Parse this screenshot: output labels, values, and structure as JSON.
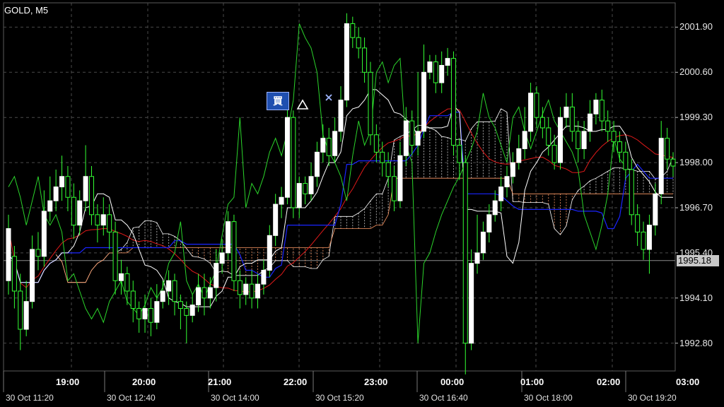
{
  "header": {
    "symbol": "GOLD, M5"
  },
  "colors": {
    "background": "#000000",
    "grid": "#4a4a4a",
    "candle_bull": "#ffffff",
    "candle_bear": "#33ff33",
    "chikou": "#2bd42b",
    "tenkan": "#ffffff",
    "kijun": "#1a24ff",
    "sma": "#e01a1a",
    "span_a": "#ffffff",
    "span_b": "#ff9a66",
    "marker_buy": "#2f4fd0",
    "current_price_bg": "#c8c8c8"
  },
  "markers": {
    "buy_label": "買",
    "buy_arrow": "△",
    "exit_mark": "×"
  },
  "current_price": "1995.18",
  "chart_data": {
    "type": "candlestick",
    "title": "GOLD, M5",
    "y_axis": {
      "range": [
        1992.0,
        2002.6
      ],
      "ticks": [
        "2001.90",
        "2000.60",
        "1999.30",
        "1998.00",
        "1996.70",
        "1995.40",
        "1994.10",
        "1992.80"
      ],
      "tick_values": [
        2001.9,
        2000.6,
        1999.3,
        1998.0,
        1996.7,
        1995.4,
        1994.1,
        1992.8
      ]
    },
    "session_times": [
      "19:00",
      "20:00",
      "21:00",
      "22:00",
      "23:00",
      "00:00",
      "01:00",
      "02:00",
      "03:00"
    ],
    "date_ticks": [
      "30 Oct 11:20",
      "30 Oct 12:40",
      "30 Oct 14:00",
      "30 Oct 15:20",
      "30 Oct 16:40",
      "30 Oct 18:00",
      "30 Oct 19:20"
    ],
    "grid": true,
    "current_price": 1995.18,
    "candles": [
      [
        1994.6,
        1996.1,
        1994.2,
        1996.5
      ],
      [
        1995.3,
        1994.3,
        1993.8,
        1995.6
      ],
      [
        1994.3,
        1993.2,
        1992.6,
        1994.8
      ],
      [
        1993.2,
        1994.0,
        1993.0,
        1994.6
      ],
      [
        1994.0,
        1995.5,
        1993.8,
        1995.9
      ],
      [
        1995.5,
        1995.3,
        1994.9,
        1996.0
      ],
      [
        1995.3,
        1996.6,
        1995.0,
        1997.2
      ],
      [
        1996.6,
        1996.9,
        1996.3,
        1997.6
      ],
      [
        1996.9,
        1997.3,
        1996.6,
        1997.8
      ],
      [
        1997.3,
        1997.6,
        1996.9,
        1998.2
      ],
      [
        1997.6,
        1997.0,
        1996.6,
        1997.9
      ],
      [
        1997.0,
        1996.2,
        1995.8,
        1997.4
      ],
      [
        1996.2,
        1996.9,
        1995.9,
        1997.2
      ],
      [
        1996.9,
        1997.6,
        1996.6,
        1998.5
      ],
      [
        1997.6,
        1996.5,
        1996.2,
        1997.9
      ],
      [
        1996.5,
        1996.2,
        1995.7,
        1996.8
      ],
      [
        1996.2,
        1996.5,
        1995.9,
        1997.0
      ],
      [
        1996.5,
        1996.0,
        1995.5,
        1996.8
      ],
      [
        1996.0,
        1994.6,
        1994.2,
        1996.3
      ],
      [
        1994.6,
        1994.8,
        1994.2,
        1995.2
      ],
      [
        1994.8,
        1994.3,
        1993.9,
        1995.0
      ],
      [
        1994.3,
        1993.8,
        1993.4,
        1994.6
      ],
      [
        1993.8,
        1993.5,
        1993.1,
        1994.0
      ],
      [
        1993.5,
        1993.8,
        1993.1,
        1994.2
      ],
      [
        1993.8,
        1993.4,
        1993.0,
        1994.1
      ],
      [
        1993.4,
        1994.0,
        1993.2,
        1994.5
      ],
      [
        1994.0,
        1994.3,
        1993.8,
        1994.6
      ],
      [
        1994.3,
        1994.6,
        1993.9,
        1994.9
      ],
      [
        1994.6,
        1994.0,
        1993.6,
        1994.8
      ],
      [
        1994.0,
        1993.8,
        1993.2,
        1994.2
      ],
      [
        1993.8,
        1993.6,
        1992.8,
        1994.0
      ],
      [
        1993.6,
        1993.9,
        1993.4,
        1994.2
      ],
      [
        1993.9,
        1994.4,
        1993.7,
        1994.8
      ],
      [
        1994.4,
        1994.1,
        1993.6,
        1994.8
      ],
      [
        1994.1,
        1994.4,
        1993.8,
        1994.7
      ],
      [
        1994.4,
        1995.1,
        1994.0,
        1995.5
      ],
      [
        1995.1,
        1995.4,
        1994.8,
        1995.8
      ],
      [
        1995.4,
        1996.3,
        1995.2,
        1996.6
      ],
      [
        1996.3,
        1994.6,
        1994.3,
        1996.5
      ],
      [
        1994.6,
        1994.2,
        1993.8,
        1994.9
      ],
      [
        1994.2,
        1994.5,
        1993.9,
        1994.7
      ],
      [
        1994.5,
        1994.1,
        1993.8,
        1994.9
      ],
      [
        1994.1,
        1994.5,
        1993.8,
        1994.8
      ],
      [
        1994.5,
        1994.9,
        1994.2,
        1995.2
      ],
      [
        1994.9,
        1995.9,
        1994.7,
        1996.2
      ],
      [
        1995.9,
        1996.8,
        1995.6,
        1997.1
      ],
      [
        1996.8,
        1997.0,
        1996.4,
        1997.3
      ],
      [
        1997.0,
        1999.3,
        1996.8,
        1999.6
      ],
      [
        1999.3,
        1996.7,
        1996.4,
        1999.5
      ],
      [
        1996.7,
        1997.4,
        1996.4,
        1997.6
      ],
      [
        1997.4,
        1997.1,
        1996.8,
        1997.6
      ],
      [
        1997.1,
        1997.6,
        1996.9,
        1998.0
      ],
      [
        1997.6,
        1998.3,
        1997.3,
        1998.6
      ],
      [
        1998.3,
        1998.7,
        1998.0,
        1999.1
      ],
      [
        1998.7,
        1998.2,
        1997.9,
        1999.0
      ],
      [
        1998.2,
        1998.9,
        1998.0,
        1999.3
      ],
      [
        1998.9,
        1999.8,
        1998.6,
        2000.2
      ],
      [
        1999.8,
        2002.0,
        1999.6,
        2002.3
      ],
      [
        2002.0,
        2001.6,
        2001.3,
        2002.2
      ],
      [
        2001.6,
        2001.3,
        2001.0,
        2001.9
      ],
      [
        2001.3,
        2000.6,
        2000.3,
        2001.6
      ],
      [
        2000.6,
        1998.8,
        1998.5,
        2000.9
      ],
      [
        1998.8,
        1998.3,
        1998.0,
        1999.1
      ],
      [
        1998.3,
        1998.0,
        1997.6,
        1998.6
      ],
      [
        1998.0,
        1997.6,
        1997.3,
        1998.3
      ],
      [
        1997.6,
        1996.9,
        1996.6,
        1997.9
      ],
      [
        1996.9,
        1998.2,
        1996.7,
        1998.6
      ],
      [
        1998.2,
        1999.2,
        1997.9,
        1999.6
      ],
      [
        1999.2,
        1998.5,
        1998.2,
        1999.5
      ],
      [
        1998.5,
        1998.9,
        1998.2,
        2000.6
      ],
      [
        1998.9,
        2000.6,
        1998.7,
        2001.4
      ],
      [
        2000.6,
        2000.9,
        2000.4,
        2001.1
      ],
      [
        2000.9,
        2000.3,
        2000.0,
        2001.1
      ],
      [
        2000.3,
        2000.8,
        2000.0,
        2001.2
      ],
      [
        2000.8,
        2001.0,
        2000.5,
        2001.3
      ],
      [
        2001.0,
        1998.5,
        1998.2,
        2001.2
      ],
      [
        1998.5,
        1998.0,
        1997.5,
        1998.7
      ],
      [
        1998.0,
        1992.8,
        1991.9,
        1998.2
      ],
      [
        1992.8,
        1995.1,
        1992.6,
        1995.5
      ],
      [
        1995.1,
        1995.4,
        1994.8,
        1996.5
      ],
      [
        1995.4,
        1996.0,
        1995.2,
        1996.3
      ],
      [
        1996.0,
        1996.5,
        1995.7,
        1996.8
      ],
      [
        1996.5,
        1996.9,
        1996.3,
        1997.2
      ],
      [
        1996.9,
        1997.3,
        1996.6,
        1997.6
      ],
      [
        1997.3,
        1997.6,
        1997.0,
        1997.9
      ],
      [
        1997.6,
        1998.0,
        1997.4,
        1998.3
      ],
      [
        1998.0,
        1998.4,
        1997.8,
        1998.8
      ],
      [
        1998.4,
        1998.9,
        1998.1,
        1999.6
      ],
      [
        1998.9,
        2000.0,
        1998.6,
        2000.3
      ],
      [
        2000.0,
        1999.3,
        1999.0,
        2000.2
      ],
      [
        1999.3,
        1999.0,
        1998.7,
        1999.6
      ],
      [
        1999.0,
        1998.5,
        1998.2,
        1999.3
      ],
      [
        1998.5,
        1998.0,
        1997.8,
        1998.8
      ],
      [
        1998.0,
        1999.3,
        1997.8,
        1999.6
      ],
      [
        1999.3,
        1999.6,
        1999.0,
        2000.0
      ],
      [
        1999.6,
        1998.9,
        1998.6,
        2000.0
      ],
      [
        1998.9,
        1998.4,
        1998.0,
        1999.2
      ],
      [
        1998.4,
        1998.9,
        1998.1,
        1999.2
      ],
      [
        1998.9,
        1999.4,
        1998.6,
        1999.8
      ],
      [
        1999.4,
        1999.8,
        1999.1,
        2000.0
      ],
      [
        1999.8,
        1999.2,
        1998.9,
        2000.1
      ],
      [
        1999.2,
        1998.9,
        1998.6,
        1999.5
      ],
      [
        1998.9,
        1998.6,
        1998.3,
        1999.2
      ],
      [
        1998.6,
        1998.3,
        1998.0,
        1998.9
      ],
      [
        1998.3,
        1997.8,
        1997.5,
        1998.6
      ],
      [
        1997.8,
        1996.5,
        1996.2,
        1998.1
      ],
      [
        1996.5,
        1996.0,
        1995.6,
        1996.8
      ],
      [
        1996.0,
        1995.5,
        1995.2,
        1996.3
      ],
      [
        1995.5,
        1996.2,
        1994.8,
        1996.5
      ],
      [
        1996.2,
        1997.1,
        1995.9,
        1997.4
      ],
      [
        1997.1,
        1998.7,
        1996.8,
        1999.2
      ],
      [
        1998.7,
        1998.1,
        1997.8,
        1999.0
      ],
      [
        1998.1,
        1997.9,
        1997.6,
        1998.3
      ]
    ]
  }
}
